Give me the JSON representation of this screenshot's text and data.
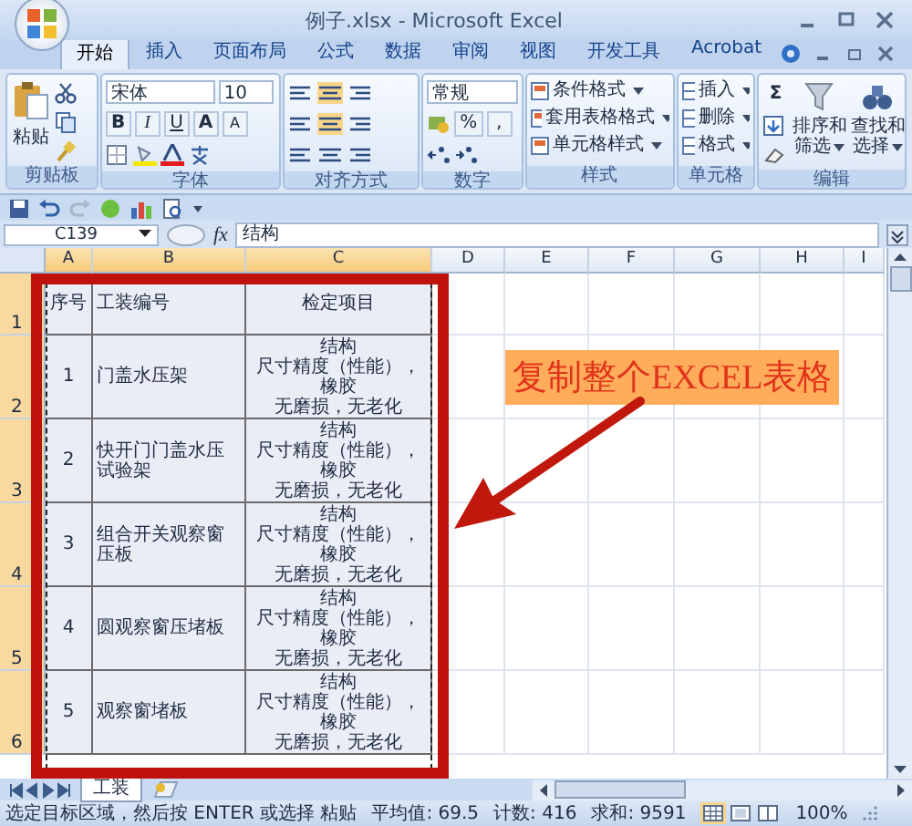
{
  "window": {
    "title": "例子.xlsx - Microsoft Excel"
  },
  "tabs": [
    {
      "label": "开始",
      "selected": true
    },
    {
      "label": "插入",
      "selected": false
    },
    {
      "label": "页面布局",
      "selected": false
    },
    {
      "label": "公式",
      "selected": false
    },
    {
      "label": "数据",
      "selected": false
    },
    {
      "label": "审阅",
      "selected": false
    },
    {
      "label": "视图",
      "selected": false
    },
    {
      "label": "开发工具",
      "selected": false
    },
    {
      "label": "Acrobat",
      "selected": false
    }
  ],
  "ribbon": {
    "clipboard": {
      "paste": "粘贴",
      "label": "剪贴板"
    },
    "font": {
      "name": "宋体",
      "size": "10",
      "styles": [
        "B",
        "I",
        "U"
      ],
      "grow": "A",
      "shrink": "A",
      "label": "字体"
    },
    "alignment": {
      "label": "对齐方式"
    },
    "number": {
      "format": "常规",
      "percent": "%",
      "comma": ",",
      "label": "数字"
    },
    "styles": {
      "items": [
        "条件格式",
        "套用表格格式",
        "单元格样式"
      ],
      "label": "样式"
    },
    "cells": {
      "items": [
        "插入",
        "删除",
        "格式"
      ],
      "label": "单元格"
    },
    "editing": {
      "sum": "Σ",
      "buttons": [
        "排序和筛选",
        "查找和选择"
      ],
      "label": "编辑"
    }
  },
  "formula_bar": {
    "name_box": "C139",
    "function_label": "fx",
    "formula": "结构"
  },
  "sheet": {
    "columns": [
      {
        "label": "A",
        "selected": true
      },
      {
        "label": "B",
        "selected": true
      },
      {
        "label": "C",
        "selected": true
      },
      {
        "label": "D",
        "selected": false
      },
      {
        "label": "E",
        "selected": false
      },
      {
        "label": "F",
        "selected": false
      },
      {
        "label": "G",
        "selected": false
      },
      {
        "label": "H",
        "selected": false
      },
      {
        "label": "I",
        "selected": false
      }
    ],
    "rows": [
      {
        "number": "1",
        "selected": true,
        "cells": [
          {
            "text": "序号"
          },
          {
            "text": "工装编号"
          },
          {
            "text": "检定项目"
          }
        ]
      },
      {
        "number": "2",
        "selected": true,
        "cells": [
          {
            "text": "1"
          },
          {
            "text": "门盖水压架"
          },
          {
            "lines": [
              "结构",
              "尺寸精度（性能），橡胶",
              "无磨损，无老化"
            ]
          }
        ]
      },
      {
        "number": "3",
        "selected": true,
        "cells": [
          {
            "text": "2"
          },
          {
            "text": "快开门门盖水压试验架"
          },
          {
            "lines": [
              "结构",
              "尺寸精度（性能），橡胶",
              "无磨损，无老化"
            ]
          }
        ]
      },
      {
        "number": "4",
        "selected": true,
        "cells": [
          {
            "text": "3"
          },
          {
            "text": "组合开关观察窗压板"
          },
          {
            "lines": [
              "结构",
              "尺寸精度（性能），橡胶",
              "无磨损，无老化"
            ]
          }
        ]
      },
      {
        "number": "5",
        "selected": true,
        "cells": [
          {
            "text": "4"
          },
          {
            "text": "圆观察窗压堵板"
          },
          {
            "lines": [
              "结构",
              "尺寸精度（性能），橡胶",
              "无磨损，无老化"
            ]
          }
        ]
      },
      {
        "number": "6",
        "selected": true,
        "cells": [
          {
            "text": "5"
          },
          {
            "text": "观察窗堵板"
          },
          {
            "lines": [
              "结构",
              "尺寸精度（性能），橡胶",
              "无磨损，无老化"
            ]
          }
        ]
      }
    ],
    "callout": "复制整个EXCEL表格"
  },
  "sheet_tabs": [
    {
      "label": "工装",
      "selected": true
    }
  ],
  "status_bar": {
    "message": "选定目标区域，然后按 ENTER 或选择  粘贴",
    "stats": [
      "平均值: 69.5",
      "计数: 416",
      "求和: 9591"
    ],
    "views": [
      {
        "selected": true
      },
      {
        "selected": false
      },
      {
        "selected": false
      }
    ],
    "zoom": "100%"
  }
}
